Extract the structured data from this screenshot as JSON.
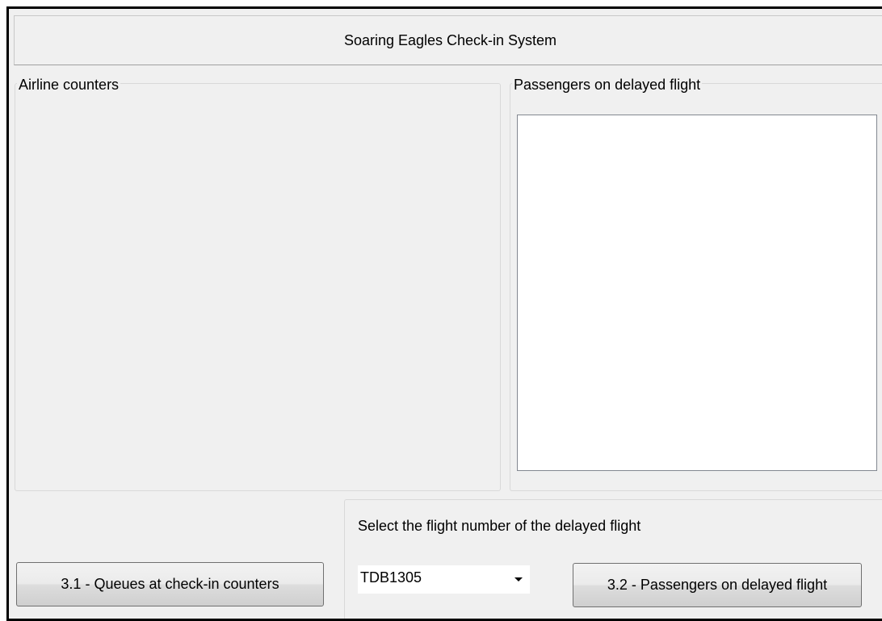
{
  "window": {
    "title": "Soaring Eagles Check-in System"
  },
  "airline_counters": {
    "label": "Airline counters"
  },
  "delayed_flight": {
    "label": "Passengers on delayed flight",
    "passengers": []
  },
  "selection": {
    "prompt": "Select the flight number of the delayed flight",
    "flight_number": "TDB1305"
  },
  "buttons": {
    "queues_label": "3.1 - Queues at check-in counters",
    "passengers_label": "3.2 - Passengers on delayed flight"
  },
  "icons": {
    "dropdown": "chevron-down-icon"
  }
}
